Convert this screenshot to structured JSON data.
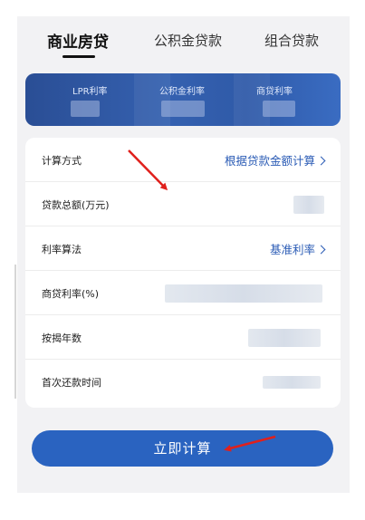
{
  "tabs": [
    {
      "label": "商业房贷",
      "active": true
    },
    {
      "label": "公积金贷款",
      "active": false
    },
    {
      "label": "组合贷款",
      "active": false
    }
  ],
  "banner": {
    "items": [
      {
        "label": "LPR利率"
      },
      {
        "label": "公积金利率"
      },
      {
        "label": "商贷利率"
      }
    ]
  },
  "form": {
    "rows": [
      {
        "label": "计算方式",
        "value": "根据贷款金额计算",
        "chevron": true
      },
      {
        "label": "贷款总额(万元)",
        "value": ""
      },
      {
        "label": "利率算法",
        "value": "基准利率",
        "chevron": true
      },
      {
        "label": "商贷利率(%)",
        "value": ""
      },
      {
        "label": "按揭年数",
        "value": ""
      },
      {
        "label": "首次还款时间",
        "value": ""
      }
    ]
  },
  "button": {
    "label": "立即计算"
  },
  "colors": {
    "accent": "#2a5bb5",
    "button": "#2a63c0",
    "annotation_arrow": "#e0201c"
  }
}
